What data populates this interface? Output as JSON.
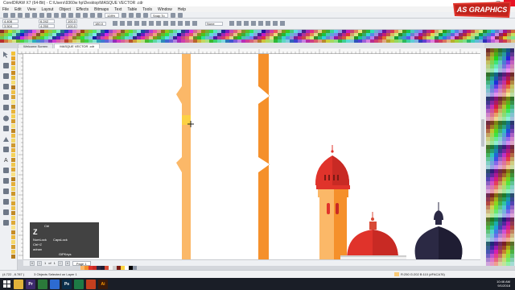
{
  "window": {
    "title": "CorelDRAW X7 (64-Bit) - C:\\Users\\9360w hp\\Desktop\\MASQUE VECTOR .cdr",
    "controls": [
      "–",
      "❐",
      "✕"
    ]
  },
  "menu": [
    "File",
    "Edit",
    "View",
    "Layout",
    "Object",
    "Effects",
    "Bitmaps",
    "Text",
    "Table",
    "Tools",
    "Window",
    "Help"
  ],
  "toolbar": {
    "zoom_value": "128%",
    "snap_label": "Snap To",
    "launch_label": "Launch"
  },
  "propbar": {
    "x": "4.408",
    "y": "3.504",
    "w": "6.242",
    "h": "4.250",
    "scale_w": "100.0",
    "scale_h": "100.0",
    "angle": "180.0",
    "outline": "None"
  },
  "tabs": [
    {
      "label": "Welcome Screen",
      "active": false
    },
    {
      "label": "MASQUE VECTOR .cdr",
      "active": true
    }
  ],
  "pagebar": {
    "current": "1",
    "of": "of",
    "total": "1",
    "page_tab": "Page 1"
  },
  "status": {
    "coords": "(4.722 , 8.787 )",
    "message": "3 Objects Selected on Layer 1",
    "fill_info": "R:250 G:202 B:110 (#FACA76)"
  },
  "clock": {
    "time": "10:46 AM",
    "date": "9/1/2018"
  },
  "watermark": {
    "text": "AS GRAPHICS"
  },
  "keystroke": {
    "top_label": "Ctrl",
    "key": "Z",
    "numlock": "NumLock",
    "capslock": "CapsLock",
    "combo": "Ctrl+Z",
    "user": "adnan",
    "app": "GiPKeys"
  },
  "colors": {
    "accent_red": "#e0332b",
    "light_orange": "#fbb868",
    "orange": "#f5902b",
    "dark_navy": "#2b2944",
    "dome_red": "#d84a36",
    "selection_yellow": "#fcd440"
  },
  "icons": {
    "cursor": "move-cursor-icon"
  }
}
